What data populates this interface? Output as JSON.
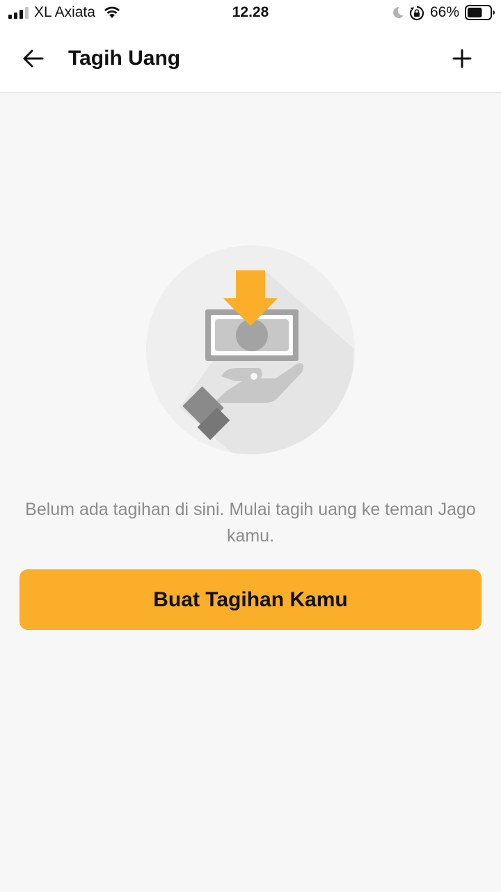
{
  "status_bar": {
    "carrier": "XL Axiata",
    "time": "12.28",
    "battery_percent": "66%",
    "battery_level": 0.66,
    "icons": [
      "signal-icon",
      "wifi-icon",
      "moon-icon",
      "orientation-lock-icon",
      "battery-icon"
    ]
  },
  "header": {
    "title": "Tagih Uang",
    "back_icon": "arrow-left-icon",
    "add_icon": "plus-icon"
  },
  "empty_state": {
    "illustration": "hand-receiving-money-illustration",
    "message": "Belum ada tagihan di sini. Mulai tagih uang ke teman Jago kamu.",
    "button_label": "Buat Tagihan Kamu"
  },
  "colors": {
    "accent": "#fbae2a",
    "background": "#f7f7f7",
    "muted_text": "#8c8c8c"
  }
}
